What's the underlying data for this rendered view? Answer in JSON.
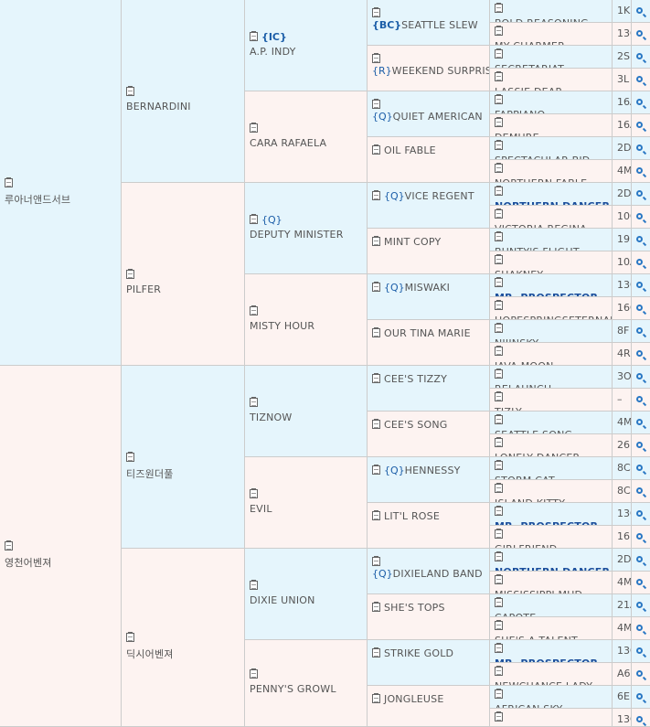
{
  "pedigree": {
    "g1": [
      {
        "name": "루아너앤드서브"
      },
      {
        "name": "영천어벤져"
      }
    ],
    "g2": [
      {
        "name": "BERNARDINI"
      },
      {
        "name": "PILFER"
      },
      {
        "name": "티즈원더풀"
      },
      {
        "name": "딕시어벤져"
      }
    ],
    "g3": [
      {
        "badge": "{IC}",
        "name": "A.P. INDY",
        "badge_bold": true
      },
      {
        "badge": "",
        "name": "CARA RAFAELA"
      },
      {
        "badge": "{Q}",
        "name": "DEPUTY MINISTER"
      },
      {
        "badge": "",
        "name": "MISTY HOUR"
      },
      {
        "badge": "",
        "name": "TIZNOW"
      },
      {
        "badge": "",
        "name": "EVIL"
      },
      {
        "badge": "",
        "name": "DIXIE UNION"
      },
      {
        "badge": "",
        "name": "PENNY'S GROWL"
      }
    ],
    "g4": [
      {
        "badge": "{BC}",
        "name": "SEATTLE SLEW",
        "badge_bold": true
      },
      {
        "badge": "{R}",
        "name": "WEEKEND SURPRISE"
      },
      {
        "badge": "{Q}",
        "name": "QUIET AMERICAN"
      },
      {
        "badge": "",
        "name": "OIL FABLE"
      },
      {
        "badge": "{Q}",
        "name": "VICE REGENT"
      },
      {
        "badge": "",
        "name": "MINT COPY"
      },
      {
        "badge": "{Q}",
        "name": "MISWAKI"
      },
      {
        "badge": "",
        "name": "OUR TINA MARIE"
      },
      {
        "badge": "",
        "name": "CEE'S TIZZY"
      },
      {
        "badge": "",
        "name": "CEE'S SONG"
      },
      {
        "badge": "{Q}",
        "name": "HENNESSY"
      },
      {
        "badge": "",
        "name": "LIT'L ROSE"
      },
      {
        "badge": "{Q}",
        "name": "DIXIELAND BAND"
      },
      {
        "badge": "",
        "name": "SHE'S TOPS"
      },
      {
        "badge": "",
        "name": "STRIKE GOLD"
      },
      {
        "badge": "",
        "name": "JONGLEUSE"
      }
    ],
    "g5": [
      {
        "name": "BOLD REASONING",
        "count": "1K",
        "bold": false
      },
      {
        "name": "MY CHARMER",
        "count": "13C",
        "bold": false
      },
      {
        "name": "SECRETARIAT",
        "count": "2S",
        "bold": false
      },
      {
        "name": "LASSIE DEAR",
        "count": "3L",
        "bold": false
      },
      {
        "name": "FAPPIANO",
        "count": "16A",
        "bold": false
      },
      {
        "name": "DEMURE",
        "count": "16A",
        "bold": false
      },
      {
        "name": "SPECTACULAR BID",
        "count": "2D",
        "bold": false
      },
      {
        "name": "NORTHERN FABLE",
        "count": "4M",
        "bold": false
      },
      {
        "name": "NORTHERN DANCER",
        "count": "2D",
        "bold": true
      },
      {
        "name": "VICTORIA REGINA",
        "count": "10C",
        "bold": false
      },
      {
        "name": "BUNTY'S FLIGHT",
        "count": "19B",
        "bold": false
      },
      {
        "name": "SHAKNEY",
        "count": "10A",
        "bold": false
      },
      {
        "name": "MR. PROSPECTOR",
        "count": "13C",
        "bold": true
      },
      {
        "name": "HOPESPRINGSETERNAL",
        "count": "16C",
        "bold": false
      },
      {
        "name": "NIJINSKY",
        "count": "8F",
        "bold": false
      },
      {
        "name": "JAVA MOON",
        "count": "4R",
        "bold": false
      },
      {
        "name": "RELAUNCH",
        "count": "3O",
        "bold": false
      },
      {
        "name": "TIZLY",
        "count": "–",
        "bold": false
      },
      {
        "name": "SEATTLE SONG",
        "count": "4M",
        "bold": false
      },
      {
        "name": "LONELY DANCER",
        "count": "26",
        "bold": false
      },
      {
        "name": "STORM CAT",
        "count": "8C",
        "bold": false
      },
      {
        "name": "ISLAND KITTY",
        "count": "8C",
        "bold": false
      },
      {
        "name": "MR. PROSPECTOR",
        "count": "13C",
        "bold": true
      },
      {
        "name": "GIRLFRIEND",
        "count": "16H",
        "bold": false
      },
      {
        "name": "NORTHERN DANCER",
        "count": "2D",
        "bold": true
      },
      {
        "name": "MISSISSIPPI MUD",
        "count": "4M",
        "bold": false
      },
      {
        "name": "CAPOTE",
        "count": "21A",
        "bold": false
      },
      {
        "name": "SHE'S A TALENT",
        "count": "4M",
        "bold": false
      },
      {
        "name": "MR. PROSPECTOR",
        "count": "13C",
        "bold": true
      },
      {
        "name": "NEWCHANCE LADY",
        "count": "A6",
        "bold": false
      },
      {
        "name": "AFRICAN SKY",
        "count": "6E",
        "bold": false
      },
      {
        "name": "JAIL BIRD",
        "count": "13C",
        "bold": false
      }
    ]
  },
  "icons": {
    "doc": "clipboard-icon",
    "search": "magnifier-icon"
  },
  "colors": {
    "sire_bg": "#e5f5fc",
    "dam_bg": "#fdf3f1",
    "link_blue": "#1c4f9c",
    "border": "#cccccc"
  }
}
